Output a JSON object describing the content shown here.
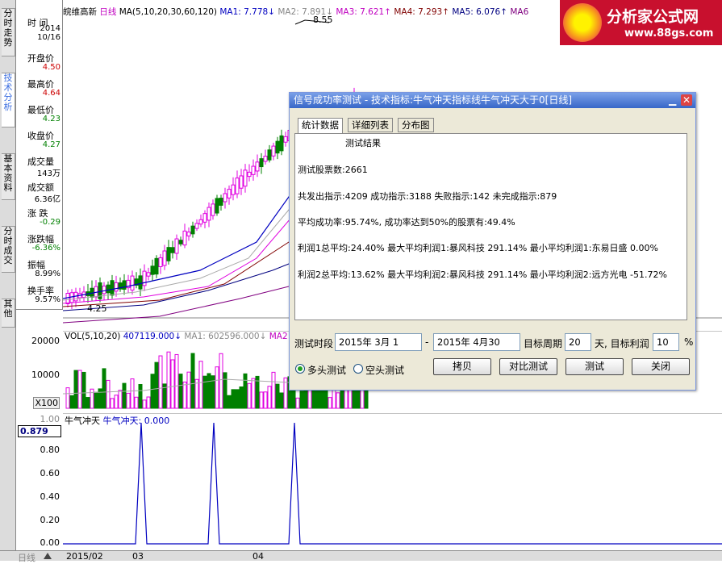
{
  "vertical_tabs": [
    "分时走势",
    "技术分析",
    "基本资料",
    "分时成交",
    "其他"
  ],
  "info": {
    "rows": [
      {
        "label": "时 间",
        "value": "2014\n10/16",
        "cls": ""
      },
      {
        "label": "开盘价",
        "value": "4.50",
        "cls": "red"
      },
      {
        "label": "最高价",
        "value": "4.64",
        "cls": "red"
      },
      {
        "label": "最低价",
        "value": "4.23",
        "cls": "green"
      },
      {
        "label": "收盘价",
        "value": "4.27",
        "cls": "green"
      },
      {
        "label": "成交量",
        "value": "143万",
        "cls": ""
      },
      {
        "label": "成交额",
        "value": "6.36亿",
        "cls": ""
      },
      {
        "label": "涨 跌",
        "value": "-0.29",
        "cls": "green"
      },
      {
        "label": "涨跌幅",
        "value": "-6.36%",
        "cls": "green"
      },
      {
        "label": "振幅",
        "value": "8.99%",
        "cls": ""
      },
      {
        "label": "换手率",
        "value": "9.57%",
        "cls": ""
      }
    ]
  },
  "legend": {
    "stock": "皖维高新",
    "period": "日线",
    "ma_spec": "MA(5,10,20,30,60,120)",
    "ma1": "MA1: 7.778↓",
    "ma2": "MA2: 7.891↓",
    "ma3": "MA3: 7.621↑",
    "ma4": "MA4: 7.293↑",
    "ma5": "MA5: 6.076↑",
    "ma6": "MA6"
  },
  "price_marks": {
    "high": "8.55",
    "low": "4.25"
  },
  "vol_legend": {
    "spec": "VOL(5,10,20)",
    "value": "407119.000↓",
    "ma1": "MA1: 602596.000↓",
    "ma2": "MA2"
  },
  "vol_axis": [
    "20000",
    "10000",
    "X100"
  ],
  "ind_legend": {
    "name": "牛气冲天",
    "value": "牛气冲天: 0.000"
  },
  "ind_axis": [
    "1.00",
    "0.879",
    "0.80",
    "0.60",
    "0.40",
    "0.20",
    "0.00"
  ],
  "dates": {
    "period": "日线",
    "d1": "2015/02",
    "d2": "03",
    "d3": "04"
  },
  "dialog": {
    "title": "信号成功率测试 - 技术指标:牛气冲天指标线牛气冲天大于0[日线]",
    "tabs": [
      "统计数据",
      "详细列表",
      "分布图"
    ],
    "result_title": "测试结果",
    "lines": [
      "测试股票数:2661",
      "共发出指示:4209 成功指示:3188 失败指示:142 未完成指示:879",
      "平均成功率:95.74%, 成功率达到50%的股票有:49.4%",
      "利润1总平均:24.40% 最大平均利润1:暴风科技 291.14% 最小平均利润1:东易日盛 0.00%",
      "利润2总平均:13.62% 最大平均利润2:暴风科技 291.14% 最小平均利润2:远方光电 -51.72%"
    ],
    "period_label": "测试时段",
    "start": "2015年 3月 1",
    "end": "2015年 4月30",
    "target_period_label": "目标周期",
    "target_period": "20",
    "days_label": "天, 目标利润",
    "target_profit": "10",
    "percent": "%",
    "long_test": "多头测试",
    "short_test": "空头测试",
    "buttons": [
      "拷贝",
      "对比测试",
      "测试",
      "关闭"
    ]
  },
  "watermark": {
    "name": "分析家公式网",
    "url": "www.88gs.com"
  }
}
